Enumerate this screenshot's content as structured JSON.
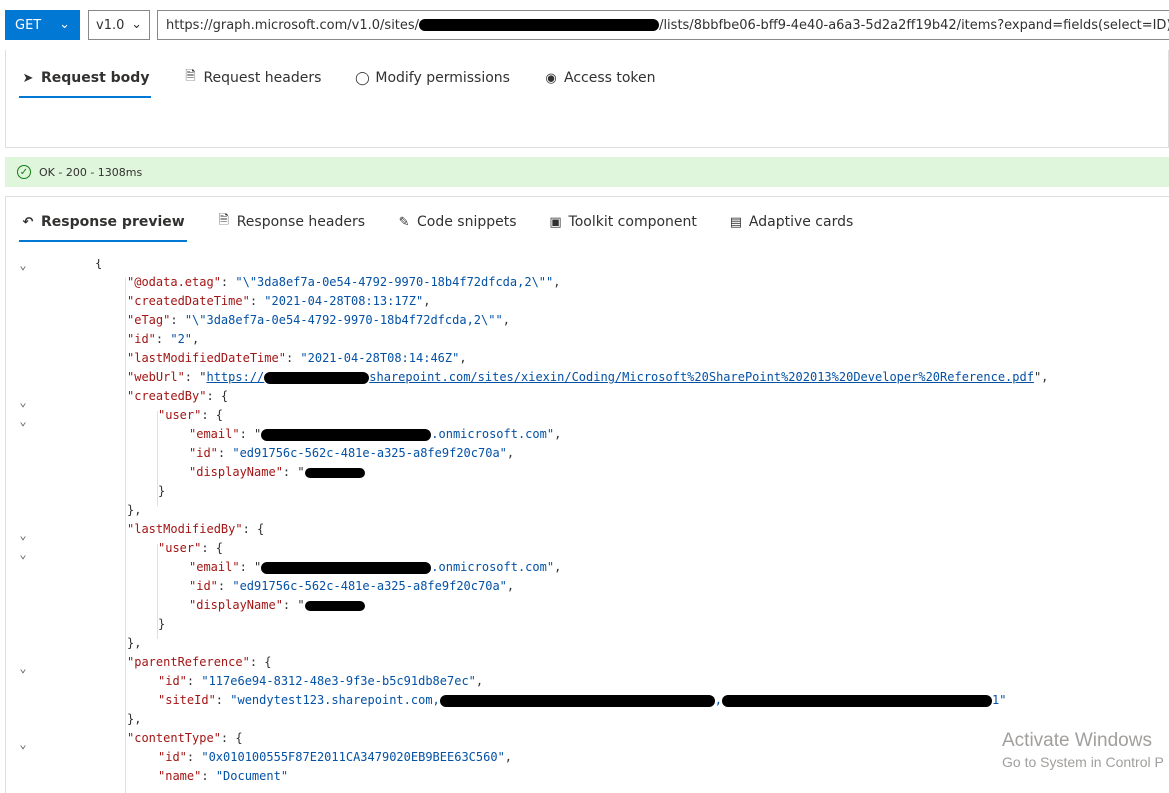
{
  "request": {
    "method": "GET",
    "version": "v1.0",
    "url_prefix": "https://graph.microsoft.com/v1.0/sites/",
    "url_suffix": "/lists/8bbfbe06-bff9-4e40-a6a3-5d2a2ff19b42/items?expand=fields(select=ID)"
  },
  "request_tabs": [
    {
      "label": "Request body",
      "icon": "send-icon"
    },
    {
      "label": "Request headers",
      "icon": "document-icon"
    },
    {
      "label": "Modify permissions",
      "icon": "shield-icon"
    },
    {
      "label": "Access token",
      "icon": "lock-icon"
    }
  ],
  "status": {
    "text": "OK - 200 - 1308ms",
    "color": "#dff6dd"
  },
  "response_tabs": [
    {
      "label": "Response preview",
      "icon": "undo-icon"
    },
    {
      "label": "Response headers",
      "icon": "document-icon"
    },
    {
      "label": "Code snippets",
      "icon": "snippet-icon"
    },
    {
      "label": "Toolkit component",
      "icon": "toolkit-icon"
    },
    {
      "label": "Adaptive cards",
      "icon": "card-icon"
    }
  ],
  "json": {
    "open_brace": "{",
    "odata_etag_key": "\"@odata.etag\"",
    "odata_etag_val": "\"\\\"3da8ef7a-0e54-4792-9970-18b4f72dfcda,2\\\"\"",
    "created_key": "\"createdDateTime\"",
    "created_val": "\"2021-04-28T08:13:17Z\"",
    "etag_key": "\"eTag\"",
    "etag_val": "\"\\\"3da8ef7a-0e54-4792-9970-18b4f72dfcda,2\\\"\"",
    "id_key": "\"id\"",
    "id_val": "\"2\"",
    "lastmod_key": "\"lastModifiedDateTime\"",
    "lastmod_val": "\"2021-04-28T08:14:46Z\"",
    "weburl_key": "\"webUrl\"",
    "weburl_prefix": "https://",
    "weburl_suffix": "sharepoint.com/sites/xiexin/Coding/Microsoft%20SharePoint%202013%20Developer%20Reference.pdf",
    "createdby_key": "\"createdBy\"",
    "user_key": "\"user\"",
    "email_key": "\"email\"",
    "email_suffix": ".onmicrosoft.com\"",
    "user_id_val": "\"ed91756c-562c-481e-a325-a8fe9f20c70a\"",
    "displayname_key": "\"displayName\"",
    "lastmodby_key": "\"lastModifiedBy\"",
    "parentref_key": "\"parentReference\"",
    "parent_id_val": "\"117e6e94-8312-48e3-9f3e-b5c91db8e7ec\"",
    "siteid_key": "\"siteId\"",
    "siteid_prefix": "\"wendytest123.sharepoint.com,",
    "siteid_suffix": "1\"",
    "contenttype_key": "\"contentType\"",
    "ct_id_val": "\"0x010100555F87E2011CA3479020EB9BEE63C560\"",
    "name_key": "\"name\"",
    "name_val": "\"Document\""
  },
  "watermark": {
    "line1": "Activate Windows",
    "line2": "Go to System in Control P"
  }
}
